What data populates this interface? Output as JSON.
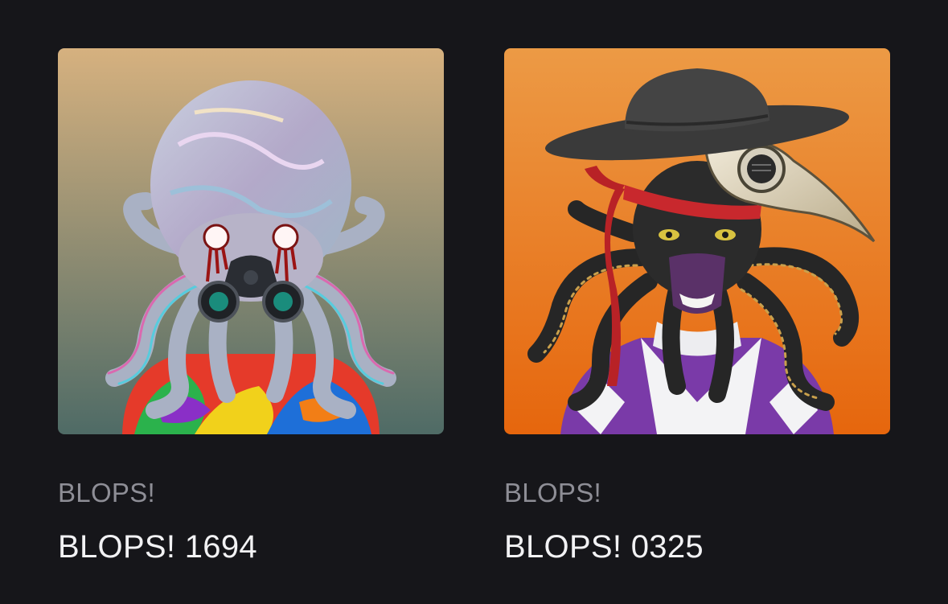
{
  "nfts": [
    {
      "collection": "BLOPS!",
      "name": "BLOPS! 1694",
      "image": "psychedelic-glitch-octopus-gas-mask",
      "background": [
        "#d6b17f",
        "#4f6b66"
      ]
    },
    {
      "collection": "BLOPS!",
      "name": "BLOPS! 0325",
      "image": "plague-doctor-octopus-hat",
      "background": [
        "#ec9a45",
        "#e6660d"
      ]
    }
  ]
}
